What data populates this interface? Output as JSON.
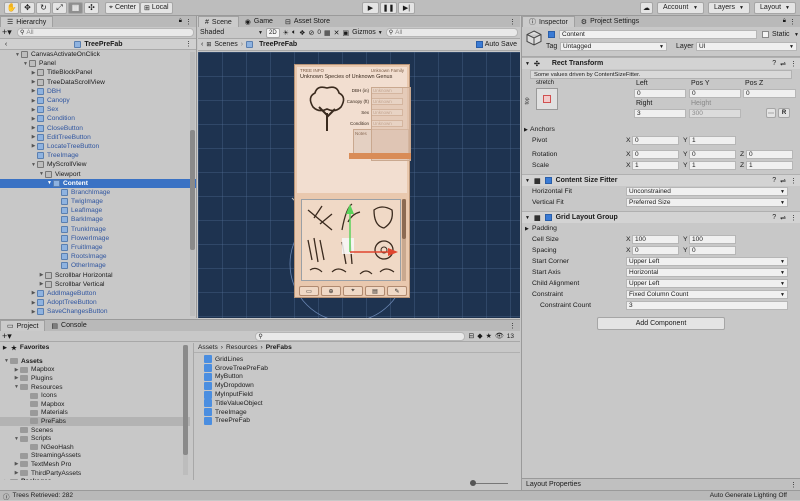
{
  "toolbar": {
    "tools": [
      "hand-tool",
      "move-tool",
      "rotate-tool",
      "scale-tool",
      "rect-tool",
      "transform-tool"
    ],
    "pivot_mode": "Center",
    "pivot_space": "Local",
    "account_label": "Account",
    "layers_label": "Layers",
    "layout_label": "Layout"
  },
  "hierarchy": {
    "tab_label": "Hierarchy",
    "search_placeholder": "All",
    "root_name": "TreePreFab",
    "items": [
      {
        "label": "CanvasActivateOnClick",
        "indent": 2,
        "arrow": "▼",
        "icon": "cube-grey",
        "style": "normal"
      },
      {
        "label": "Panel",
        "indent": 3,
        "arrow": "▼",
        "icon": "cube-grey",
        "style": "normal"
      },
      {
        "label": "TitleBlockPanel",
        "indent": 4,
        "arrow": "▶",
        "icon": "cube-grey",
        "style": "normal"
      },
      {
        "label": "TreeDataScrollView",
        "indent": 4,
        "arrow": "▶",
        "icon": "cube-grey",
        "style": "normal"
      },
      {
        "label": "DBH",
        "indent": 4,
        "arrow": "▶",
        "icon": "cube",
        "style": "blue"
      },
      {
        "label": "Canopy",
        "indent": 4,
        "arrow": "▶",
        "icon": "cube",
        "style": "blue"
      },
      {
        "label": "Sex",
        "indent": 4,
        "arrow": "▶",
        "icon": "cube",
        "style": "blue"
      },
      {
        "label": "Condition",
        "indent": 4,
        "arrow": "▶",
        "icon": "cube",
        "style": "blue"
      },
      {
        "label": "CloseButton",
        "indent": 4,
        "arrow": "▶",
        "icon": "cube",
        "style": "blue"
      },
      {
        "label": "EditTreeButton",
        "indent": 4,
        "arrow": "▶",
        "icon": "cube",
        "style": "blue"
      },
      {
        "label": "LocateTreeButton",
        "indent": 4,
        "arrow": "▶",
        "icon": "cube",
        "style": "blue"
      },
      {
        "label": "TreeImage",
        "indent": 4,
        "arrow": "",
        "icon": "cube",
        "style": "blue"
      },
      {
        "label": "MyScrollView",
        "indent": 4,
        "arrow": "▼",
        "icon": "cube-grey",
        "style": "normal"
      },
      {
        "label": "Viewport",
        "indent": 5,
        "arrow": "▼",
        "icon": "cube-grey",
        "style": "normal"
      },
      {
        "label": "Content",
        "indent": 6,
        "arrow": "▼",
        "icon": "cube",
        "style": "selected"
      },
      {
        "label": "BranchImage",
        "indent": 7,
        "arrow": "",
        "icon": "cube",
        "style": "blue"
      },
      {
        "label": "TwigImage",
        "indent": 7,
        "arrow": "",
        "icon": "cube",
        "style": "blue"
      },
      {
        "label": "LeafImage",
        "indent": 7,
        "arrow": "",
        "icon": "cube",
        "style": "blue"
      },
      {
        "label": "BarkImage",
        "indent": 7,
        "arrow": "",
        "icon": "cube",
        "style": "blue"
      },
      {
        "label": "TrunkImage",
        "indent": 7,
        "arrow": "",
        "icon": "cube",
        "style": "blue"
      },
      {
        "label": "FlowerImage",
        "indent": 7,
        "arrow": "",
        "icon": "cube",
        "style": "blue"
      },
      {
        "label": "FruitImage",
        "indent": 7,
        "arrow": "",
        "icon": "cube",
        "style": "blue"
      },
      {
        "label": "RootsImage",
        "indent": 7,
        "arrow": "",
        "icon": "cube",
        "style": "blue"
      },
      {
        "label": "OtherImage",
        "indent": 7,
        "arrow": "",
        "icon": "cube",
        "style": "blue"
      },
      {
        "label": "Scrollbar Horizontal",
        "indent": 5,
        "arrow": "▶",
        "icon": "cube-grey",
        "style": "normal"
      },
      {
        "label": "Scrollbar Vertical",
        "indent": 5,
        "arrow": "▶",
        "icon": "cube-grey",
        "style": "normal"
      },
      {
        "label": "AddImageButton",
        "indent": 4,
        "arrow": "▶",
        "icon": "cube",
        "style": "blue"
      },
      {
        "label": "AdoptTreeButton",
        "indent": 4,
        "arrow": "▶",
        "icon": "cube",
        "style": "blue"
      },
      {
        "label": "SaveChangesButton",
        "indent": 4,
        "arrow": "▶",
        "icon": "cube",
        "style": "blue"
      },
      {
        "label": "TakePhotoPanel",
        "indent": 4,
        "arrow": "▶",
        "icon": "cube-grey",
        "style": "faded"
      }
    ]
  },
  "scene": {
    "tabs": [
      "Scene",
      "Game",
      "Asset Store"
    ],
    "shading": "Shaded",
    "mode_2d": "2D",
    "gizmos": "Gizmos",
    "search_placeholder": "All",
    "hidden_count": "0",
    "breadcrumb_root": "Scenes",
    "breadcrumb_prefab": "TreePreFab",
    "auto_save": "Auto Save",
    "card_title_left": "TREE INFO",
    "card_title_right": "Unknown Family",
    "card_heading": "Unknown Species of Unknown Genus",
    "card_fields": [
      {
        "label": "DBH (in)",
        "value": "Unknown"
      },
      {
        "label": "Canopy (ft)",
        "value": "Unknown"
      },
      {
        "label": "Sex",
        "value": "Unknown"
      },
      {
        "label": "Condition",
        "value": "Unknown"
      }
    ],
    "card_notes": "Notes"
  },
  "project": {
    "tabs": [
      "Project",
      "Console"
    ],
    "favorites_label": "Favorites",
    "assets_label": "Assets",
    "tree": [
      {
        "label": "Assets",
        "indent": 0,
        "arrow": "▼",
        "bold": true
      },
      {
        "label": "Mapbox",
        "indent": 1,
        "arrow": "▶",
        "bold": false
      },
      {
        "label": "Plugins",
        "indent": 1,
        "arrow": "▶",
        "bold": false
      },
      {
        "label": "Resources",
        "indent": 1,
        "arrow": "▼",
        "bold": false
      },
      {
        "label": "Icons",
        "indent": 2,
        "arrow": "",
        "bold": false
      },
      {
        "label": "Mapbox",
        "indent": 2,
        "arrow": "",
        "bold": false
      },
      {
        "label": "Materials",
        "indent": 2,
        "arrow": "",
        "bold": false
      },
      {
        "label": "PreFabs",
        "indent": 2,
        "arrow": "",
        "bold": false,
        "selected": true
      },
      {
        "label": "Scenes",
        "indent": 1,
        "arrow": "",
        "bold": false
      },
      {
        "label": "Scripts",
        "indent": 1,
        "arrow": "▼",
        "bold": false
      },
      {
        "label": "NGeoHash",
        "indent": 2,
        "arrow": "",
        "bold": false
      },
      {
        "label": "StreamingAssets",
        "indent": 1,
        "arrow": "",
        "bold": false
      },
      {
        "label": "TextMesh Pro",
        "indent": 1,
        "arrow": "▶",
        "bold": false
      },
      {
        "label": "ThirdPartyAssets",
        "indent": 1,
        "arrow": "▶",
        "bold": false
      },
      {
        "label": "Packages",
        "indent": 0,
        "arrow": "▶",
        "bold": true
      }
    ],
    "breadcrumb": [
      "Assets",
      "Resources",
      "PreFabs"
    ],
    "file_count": "13",
    "files": [
      "GridLines",
      "GroveTreePreFab",
      "MyButton",
      "MyDropdown",
      "MyInputField",
      "TitleValueObject",
      "TreeImage",
      "TreePreFab"
    ]
  },
  "inspector": {
    "tabs": [
      "Inspector",
      "Project Settings"
    ],
    "object_name": "Content",
    "static_label": "Static",
    "tag_label": "Tag",
    "tag_value": "Untagged",
    "layer_label": "Layer",
    "layer_value": "UI",
    "rect_transform": {
      "title": "Rect Transform",
      "notice": "Some values driven by ContentSizeFitter.",
      "anchor_preset": "stretch",
      "anchor_side": "top",
      "cols": [
        "Left",
        "Pos Y",
        "Pos Z"
      ],
      "vals": [
        "0",
        "0",
        "0"
      ],
      "cols2": [
        "Right",
        "Height"
      ],
      "vals2": [
        "3",
        "300"
      ],
      "anchors_label": "Anchors",
      "pivot_label": "Pivot",
      "pivot": {
        "x": "0",
        "y": "1"
      },
      "rotation_label": "Rotation",
      "rotation": {
        "x": "0",
        "y": "0",
        "z": "0"
      },
      "scale_label": "Scale",
      "scale": {
        "x": "1",
        "y": "1",
        "z": "1"
      }
    },
    "content_size_fitter": {
      "title": "Content Size Fitter",
      "horizontal_label": "Horizontal Fit",
      "horizontal_value": "Unconstrained",
      "vertical_label": "Vertical Fit",
      "vertical_value": "Preferred Size"
    },
    "grid_layout_group": {
      "title": "Grid Layout Group",
      "padding_label": "Padding",
      "cell_size_label": "Cell Size",
      "cell_size": {
        "x": "100",
        "y": "100"
      },
      "spacing_label": "Spacing",
      "spacing": {
        "x": "0",
        "y": "0"
      },
      "start_corner_label": "Start Corner",
      "start_corner": "Upper Left",
      "start_axis_label": "Start Axis",
      "start_axis": "Horizontal",
      "child_alignment_label": "Child Alignment",
      "child_alignment": "Upper Left",
      "constraint_label": "Constraint",
      "constraint": "Fixed Column Count",
      "constraint_count_label": "Constraint Count",
      "constraint_count": "3"
    },
    "add_component": "Add Component",
    "layout_properties": "Layout Properties"
  },
  "status": {
    "message": "Trees Retrieved: 282",
    "lighting": "Auto Generate Lighting Off"
  },
  "colors": {
    "selected_row": "#3a72c4",
    "scene_bg": "#1e3350",
    "card_bg": "#f2ded0",
    "accent_blue": "#2f55a0"
  }
}
